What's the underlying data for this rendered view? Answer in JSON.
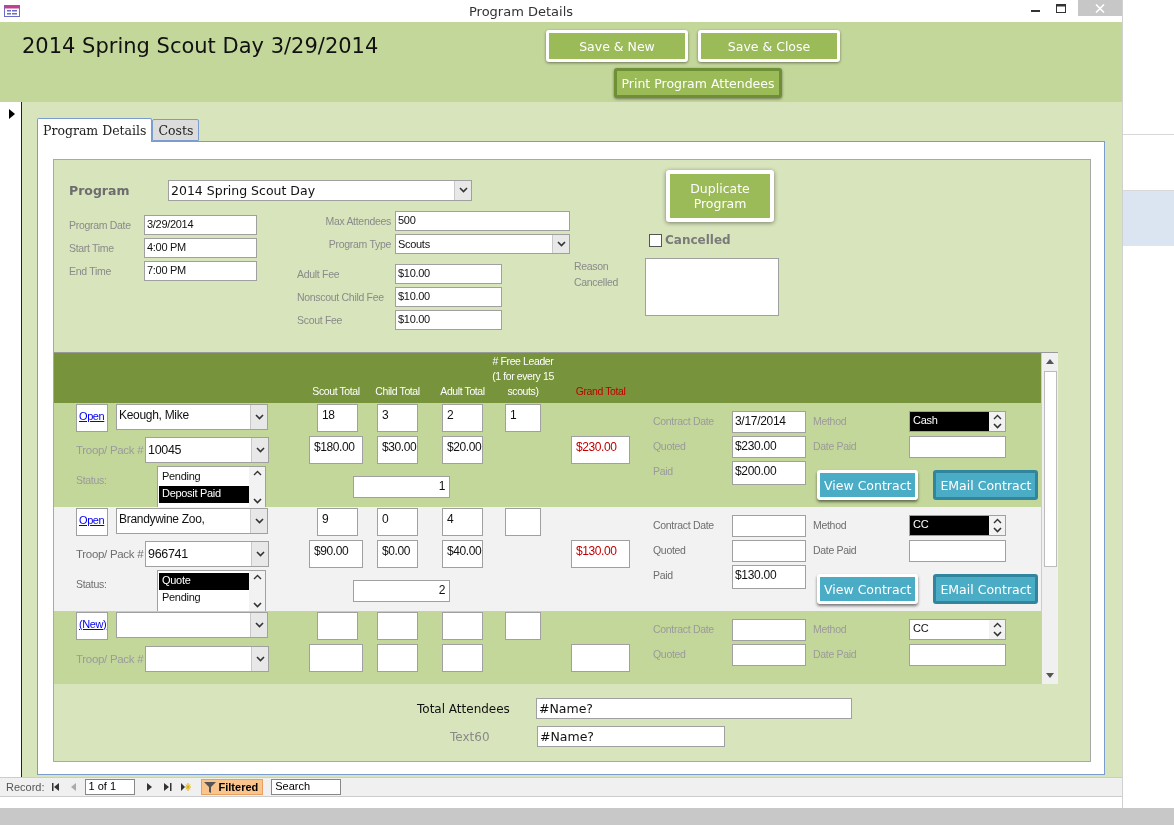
{
  "window": {
    "title": "Program Details"
  },
  "header": {
    "title": "2014 Spring Scout Day 3/29/2014",
    "buttons": [
      {
        "label": "Save & New",
        "kind": "plain"
      },
      {
        "label": "Save & Close",
        "kind": "plain"
      },
      {
        "label": "Print Program Attendees",
        "kind": "dark"
      }
    ]
  },
  "tabs": [
    {
      "label": "Program Details",
      "selected": true
    },
    {
      "label": "Costs",
      "selected": false
    }
  ],
  "program": {
    "label": "Program",
    "value": "2014 Spring Scout Day"
  },
  "schedule": [
    {
      "label": "Program Date",
      "value": "3/29/2014"
    },
    {
      "label": "Start Time",
      "value": "4:00 PM"
    },
    {
      "label": "End Time",
      "value": "7:00 PM"
    }
  ],
  "settings": [
    {
      "label": "Max Attendees",
      "value": "500",
      "kind": "text"
    },
    {
      "label": "Program Type",
      "value": "Scouts",
      "kind": "combo"
    }
  ],
  "fees": [
    {
      "label": "Adult Fee",
      "value": "$10.00"
    },
    {
      "label": "Nonscout Child Fee",
      "value": "$10.00"
    },
    {
      "label": "Scout Fee",
      "value": "$10.00"
    }
  ],
  "duplicate_button": "Duplicate Program",
  "cancelled": {
    "label": "Cancelled",
    "checked": false
  },
  "reason": {
    "label": "Reason Cancelled"
  },
  "attendees": {
    "columns": [
      {
        "label": "Scout Total",
        "kind": "normal"
      },
      {
        "label": "Child Total",
        "kind": "normal"
      },
      {
        "label": "Adult Total",
        "kind": "normal"
      },
      {
        "label": "# Free Leader (1 for every 15 scouts)",
        "kind": "normal"
      },
      {
        "label": "Grand Total",
        "kind": "alert"
      }
    ],
    "rows": [
      {
        "link": "Open",
        "contact": "Keough, Mike",
        "troop_label": "Troop/ Pack #",
        "troop": "10045",
        "status_label": "Status:",
        "status_options": [
          {
            "label": "Pending",
            "selected": false
          },
          {
            "label": "Deposit Paid",
            "selected": true
          }
        ],
        "scouts": "18",
        "children": "3",
        "adults": "2",
        "free_leaders": "1",
        "scout_cost": "$180.00",
        "child_cost": "$30.00",
        "adult_cost": "$20.00",
        "grand_total": "$230.00",
        "sequence": "1",
        "contract_date_label": "Contract Date",
        "contract_date": "3/17/2014",
        "method_label": "Method",
        "method": "Cash",
        "method_selected": true,
        "quoted_label": "Quoted",
        "quoted": "$230.00",
        "date_paid_label": "Date Paid",
        "paid_label": "Paid",
        "paid": "$200.00",
        "buttons": [
          {
            "label": "View Contract",
            "kind": "view"
          },
          {
            "label": "EMail Contract",
            "kind": "email"
          }
        ]
      },
      {
        "link": "Open",
        "contact": "Brandywine Zoo,",
        "troop_label": "Troop/ Pack #",
        "troop": "966741",
        "status_label": "Status:",
        "status_options": [
          {
            "label": "Quote",
            "selected": true
          },
          {
            "label": "Pending",
            "selected": false
          }
        ],
        "scouts": "9",
        "children": "0",
        "adults": "4",
        "scout_cost": "$90.00",
        "child_cost": "$0.00",
        "adult_cost": "$40.00",
        "grand_total": "$130.00",
        "sequence": "2",
        "contract_date_label": "Contract Date",
        "method_label": "Method",
        "method": "CC",
        "method_selected": true,
        "quoted_label": "Quoted",
        "date_paid_label": "Date Paid",
        "paid_label": "Paid",
        "paid": "$130.00",
        "buttons": [
          {
            "label": "View Contract",
            "kind": "view"
          },
          {
            "label": "EMail Contract",
            "kind": "email"
          }
        ]
      },
      {
        "link": "(New)",
        "troop_label": "Troop/ Pack #",
        "contract_date_label": "Contract Date",
        "method_label": "Method",
        "method": "CC",
        "method_selected": false,
        "quoted_label": "Quoted",
        "date_paid_label": "Date Paid"
      }
    ]
  },
  "totals": [
    {
      "label": "Total Attendees",
      "value": "#Name?",
      "kind": "main"
    },
    {
      "label": "Text60",
      "value": "#Name?",
      "kind": "muted"
    }
  ],
  "record_nav": {
    "label": "Record:",
    "position": "1 of 1",
    "filter": "Filtered",
    "search": "Search"
  }
}
